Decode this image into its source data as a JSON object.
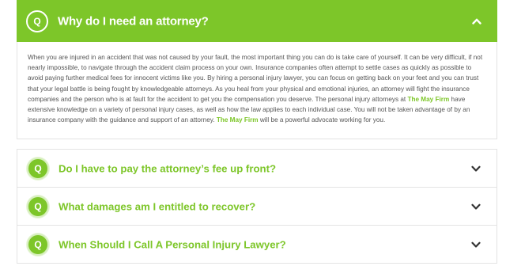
{
  "faq": {
    "badge": "Q",
    "open_item": {
      "question": "Why do I need an attorney?",
      "answer_parts": {
        "p1": "When you are injured in an accident that was not caused by your fault, the most important thing you can do is take care of yourself. It can be very difficult, if not nearly impossible, to navigate through the accident claim process on your own. Insurance companies often attempt to settle cases as quickly as possible to avoid paying further medical fees for innocent victims like you. By hiring a personal injury lawyer, you can focus on getting back on your feet and you can trust that your legal battle is being fought by knowledgeable attorneys. As you heal from your physical and emotional injuries, an attorney will fight the insurance companies and the person who is at fault for the accident to get you the compensation you deserve. The personal injury attorneys at ",
        "firm1": "The May Firm",
        "p2": " have extensive knowledge on a variety of personal injury cases, as well as how the law applies to each individual case. You will not be taken advantage of by an insurance company with the guidance and support of an attorney. ",
        "firm2": "The May Firm",
        "p3": " will be a powerful advocate working for you."
      }
    },
    "closed_items": [
      {
        "question": "Do I have to pay the attorney’s fee up front?"
      },
      {
        "question": "What damages am I entitled to recover?"
      },
      {
        "question": "When Should I Call A Personal Injury Lawyer?"
      }
    ],
    "colors": {
      "accent": "#7dc629",
      "text": "#555555",
      "border": "#e3e3e3"
    },
    "icons": {
      "open": "chevron-up-icon",
      "closed": "chevron-down-icon"
    }
  }
}
